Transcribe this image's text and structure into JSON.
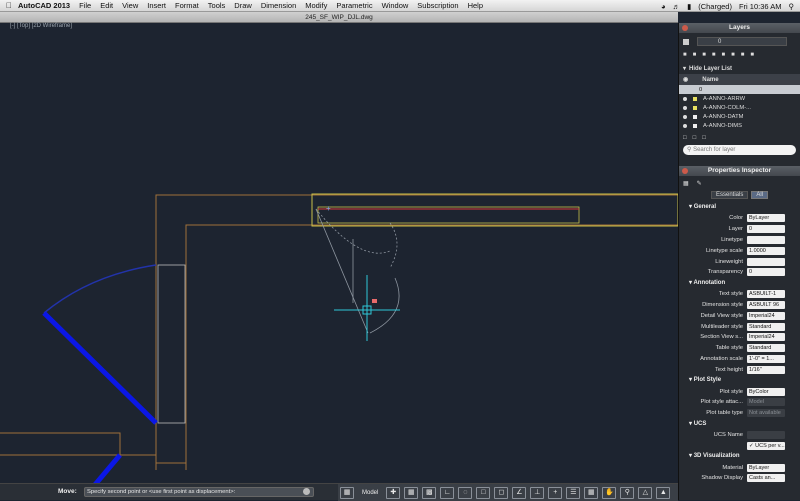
{
  "menubar": {
    "app_name": "AutoCAD 2013",
    "items": [
      "File",
      "Edit",
      "View",
      "Insert",
      "Format",
      "Tools",
      "Draw",
      "Dimension",
      "Modify",
      "Parametric",
      "Window",
      "Subscription",
      "Help"
    ],
    "battery": "(Charged)",
    "clock": "Fri 10:36 AM"
  },
  "document": {
    "title": "245_SF_WIP_DJL.dwg"
  },
  "viewport": {
    "label": "[-] [Top] [2D Wireframe]"
  },
  "command_line": {
    "label": "Move:",
    "prompt": "Specify second point or <use first point as displacement>:"
  },
  "statusbar": {
    "model_label": "Model"
  },
  "layers_panel": {
    "title": "Layers",
    "current_layer": "0",
    "hide_list_label": "Hide Layer List",
    "column_name": "Name",
    "rows": [
      "0",
      "A-ANNO-ARRW",
      "A-ANNO-COLM-...",
      "A-ANNO-DATM",
      "A-ANNO-DIMS"
    ],
    "search_placeholder": "Search for layer"
  },
  "properties_panel": {
    "title": "Properties Inspector",
    "tab_essentials": "Essentials",
    "tab_all": "All",
    "sections": {
      "general": "General",
      "annotation": "Annotation",
      "plot_style": "Plot Style",
      "ucs": "UCS",
      "viz": "3D Visualization"
    },
    "general": [
      {
        "label": "Color",
        "value": "ByLayer"
      },
      {
        "label": "Layer",
        "value": "0"
      },
      {
        "label": "Linetype",
        "value": ""
      },
      {
        "label": "Linetype scale",
        "value": "1.0000"
      },
      {
        "label": "Lineweight",
        "value": ""
      },
      {
        "label": "Transparency",
        "value": "0"
      }
    ],
    "annotation": [
      {
        "label": "Text style",
        "value": "ASBUILT-1"
      },
      {
        "label": "Dimension style",
        "value": "ASBUILT 96"
      },
      {
        "label": "Detail View style",
        "value": "Imperial24"
      },
      {
        "label": "Multileader style",
        "value": "Standard"
      },
      {
        "label": "Section View s...",
        "value": "Imperial24"
      },
      {
        "label": "Table style",
        "value": "Standard"
      },
      {
        "label": "Annotation scale",
        "value": "1'-0\" = 1..."
      },
      {
        "label": "Text height",
        "value": "1/16\""
      }
    ],
    "plot": [
      {
        "label": "Plot style",
        "value": "ByColor"
      },
      {
        "label": "Plot style attac...",
        "value": "Model"
      },
      {
        "label": "Plot table type",
        "value": "Not available"
      }
    ],
    "ucs": {
      "label": "UCS Name",
      "value": "",
      "checkbox": "UCS per v..."
    },
    "viz": [
      {
        "label": "Material",
        "value": "ByLayer"
      },
      {
        "label": "Shadow Display",
        "value": "Casts an..."
      }
    ]
  }
}
